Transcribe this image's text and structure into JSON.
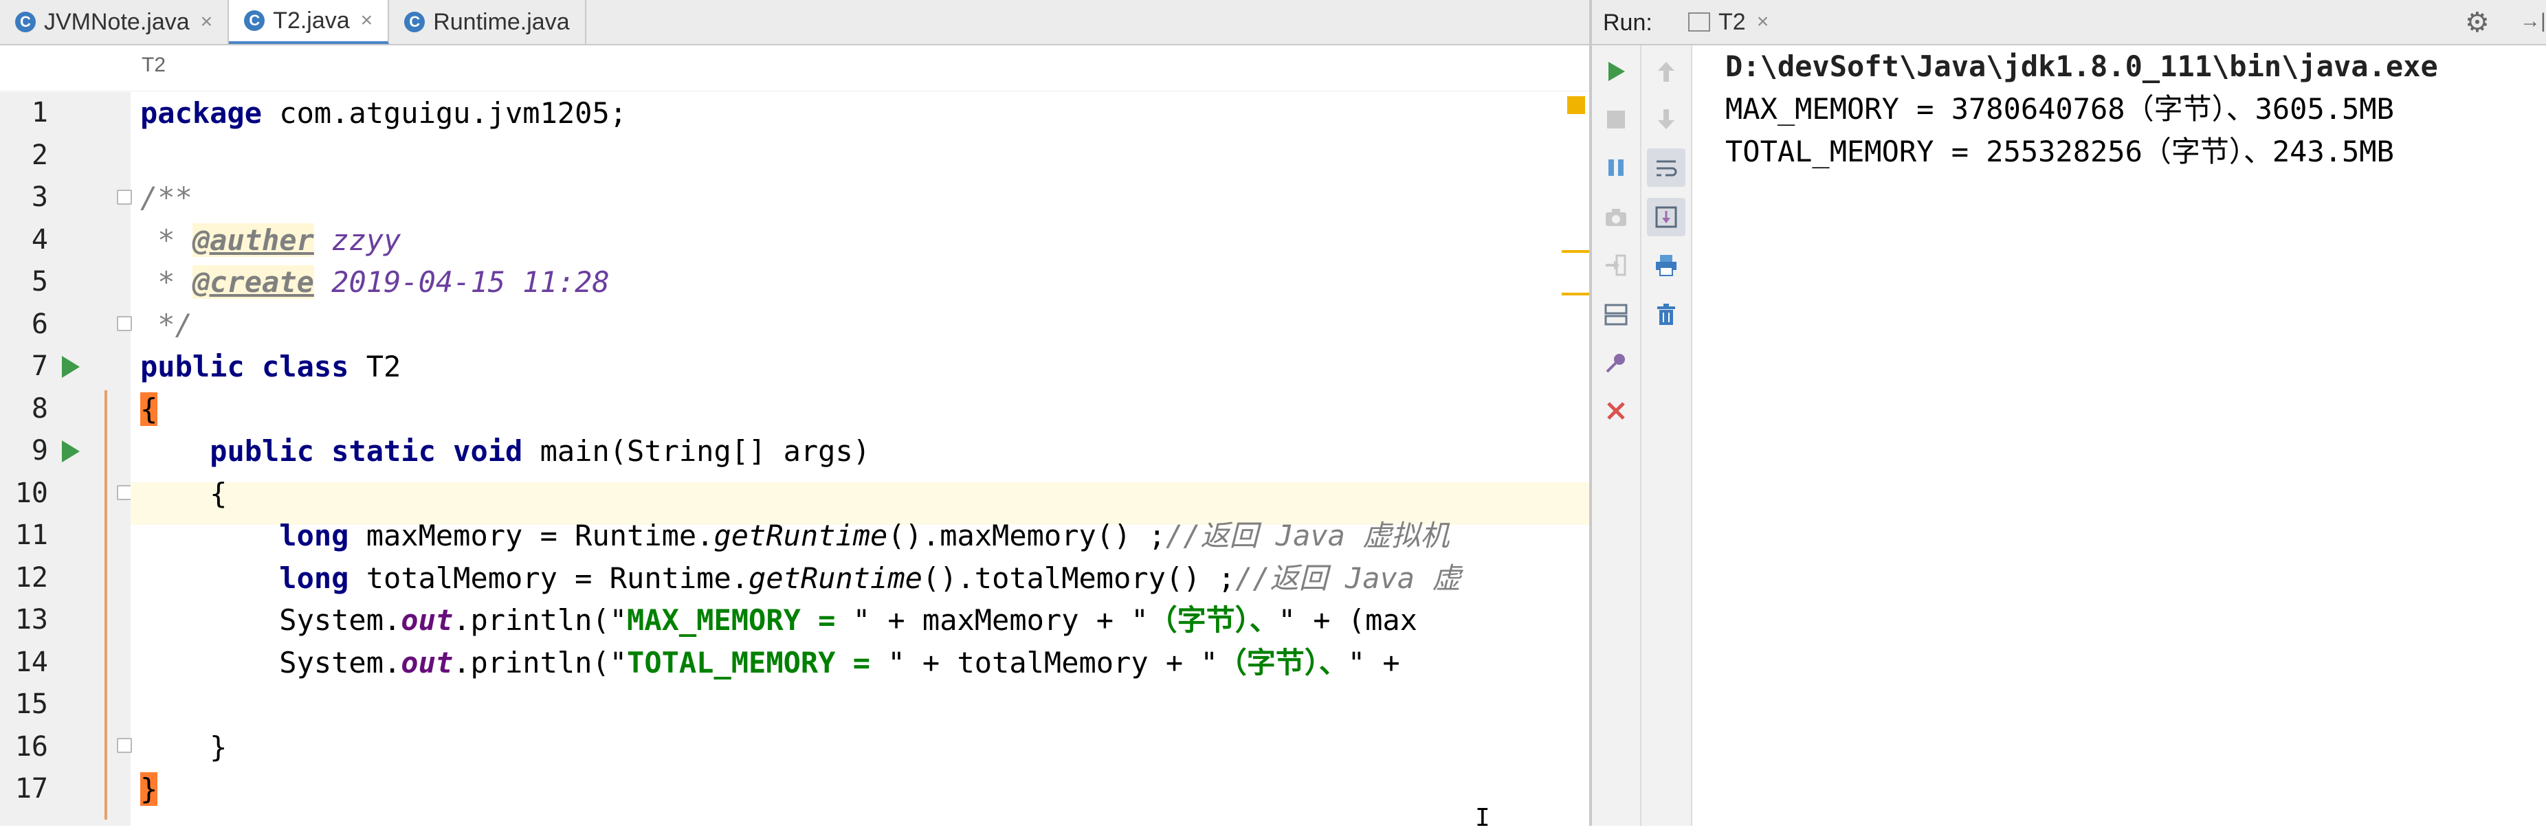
{
  "editor": {
    "tabs": [
      {
        "label": "JVMNote.java",
        "close": "×",
        "icon": "C",
        "active": false
      },
      {
        "label": "T2.java",
        "close": "×",
        "icon": "C",
        "active": true
      },
      {
        "label": "Runtime.java",
        "close": "×",
        "icon": "C",
        "active": false
      }
    ],
    "breadcrumb": "T2",
    "line_numbers": [
      "1",
      "2",
      "3",
      "4",
      "5",
      "6",
      "7",
      "8",
      "9",
      "10",
      "11",
      "12",
      "13",
      "14",
      "15",
      "16",
      "17"
    ],
    "code": {
      "l1_kw": "package",
      "l1_rest": " com.atguigu.jvm1205;",
      "l3": "/**",
      "l4_star": " * ",
      "l4_tag": "@auther",
      "l4_val": " zzyy",
      "l5_star": " * ",
      "l5_tag": "@create",
      "l5_val": " 2019-04-15 11:28",
      "l6": " */",
      "l7_kw": "public class",
      "l7_rest": " T2",
      "l8_brace": "{",
      "l9_indent": "    ",
      "l9_kw": "public static void",
      "l9_rest": " main(String[] args)",
      "l10": "    {",
      "l11_indent": "        ",
      "l11_kw": "long",
      "l11_a": " maxMemory = Runtime.",
      "l11_m": "getRuntime",
      "l11_b": "().maxMemory() ;",
      "l11_cm": "//返回 Java 虚拟机",
      "l12_indent": "        ",
      "l12_kw": "long",
      "l12_a": " totalMemory = Runtime.",
      "l12_m": "getRuntime",
      "l12_b": "().totalMemory() ;",
      "l12_cm": "//返回 Java 虚",
      "l13_a": "        System.",
      "l13_out": "out",
      "l13_b": ".println(\"",
      "l13_str1": "MAX_MEMORY = ",
      "l13_c": "\" + maxMemory + \"",
      "l13_str2": "（字节）、",
      "l13_d": "\" + (max",
      "l14_a": "        System.",
      "l14_out": "out",
      "l14_b": ".println(\"",
      "l14_str1": "TOTAL_MEMORY = ",
      "l14_c": "\" + totalMemory + \"",
      "l14_str2": "（字节）、",
      "l14_d": "\" +",
      "l16": "    }",
      "l17_brace": "}"
    }
  },
  "run": {
    "label": "Run:",
    "tab_label": "T2",
    "tab_close": "×",
    "gear": "⚙",
    "pin": "→|",
    "output": [
      "D:\\devSoft\\Java\\jdk1.8.0_111\\bin\\java.exe",
      "MAX_MEMORY = 3780640768（字节）、3605.5MB",
      "TOTAL_MEMORY = 255328256（字节）、243.5MB"
    ],
    "toolbar_left": [
      "run-icon",
      "stop-icon",
      "pause-icon",
      "camera-icon",
      "login-icon",
      "layout-icon",
      "pin-icon",
      "close-icon"
    ],
    "toolbar_right": [
      "up-arrow-icon",
      "down-arrow-icon",
      "soft-wrap-icon",
      "scroll-to-end-icon",
      "print-icon",
      "trash-icon"
    ],
    "colors": {
      "run_green": "#3f9a4a",
      "stop_red": "#d9534f",
      "accent_blue": "#3b7bbf"
    }
  }
}
